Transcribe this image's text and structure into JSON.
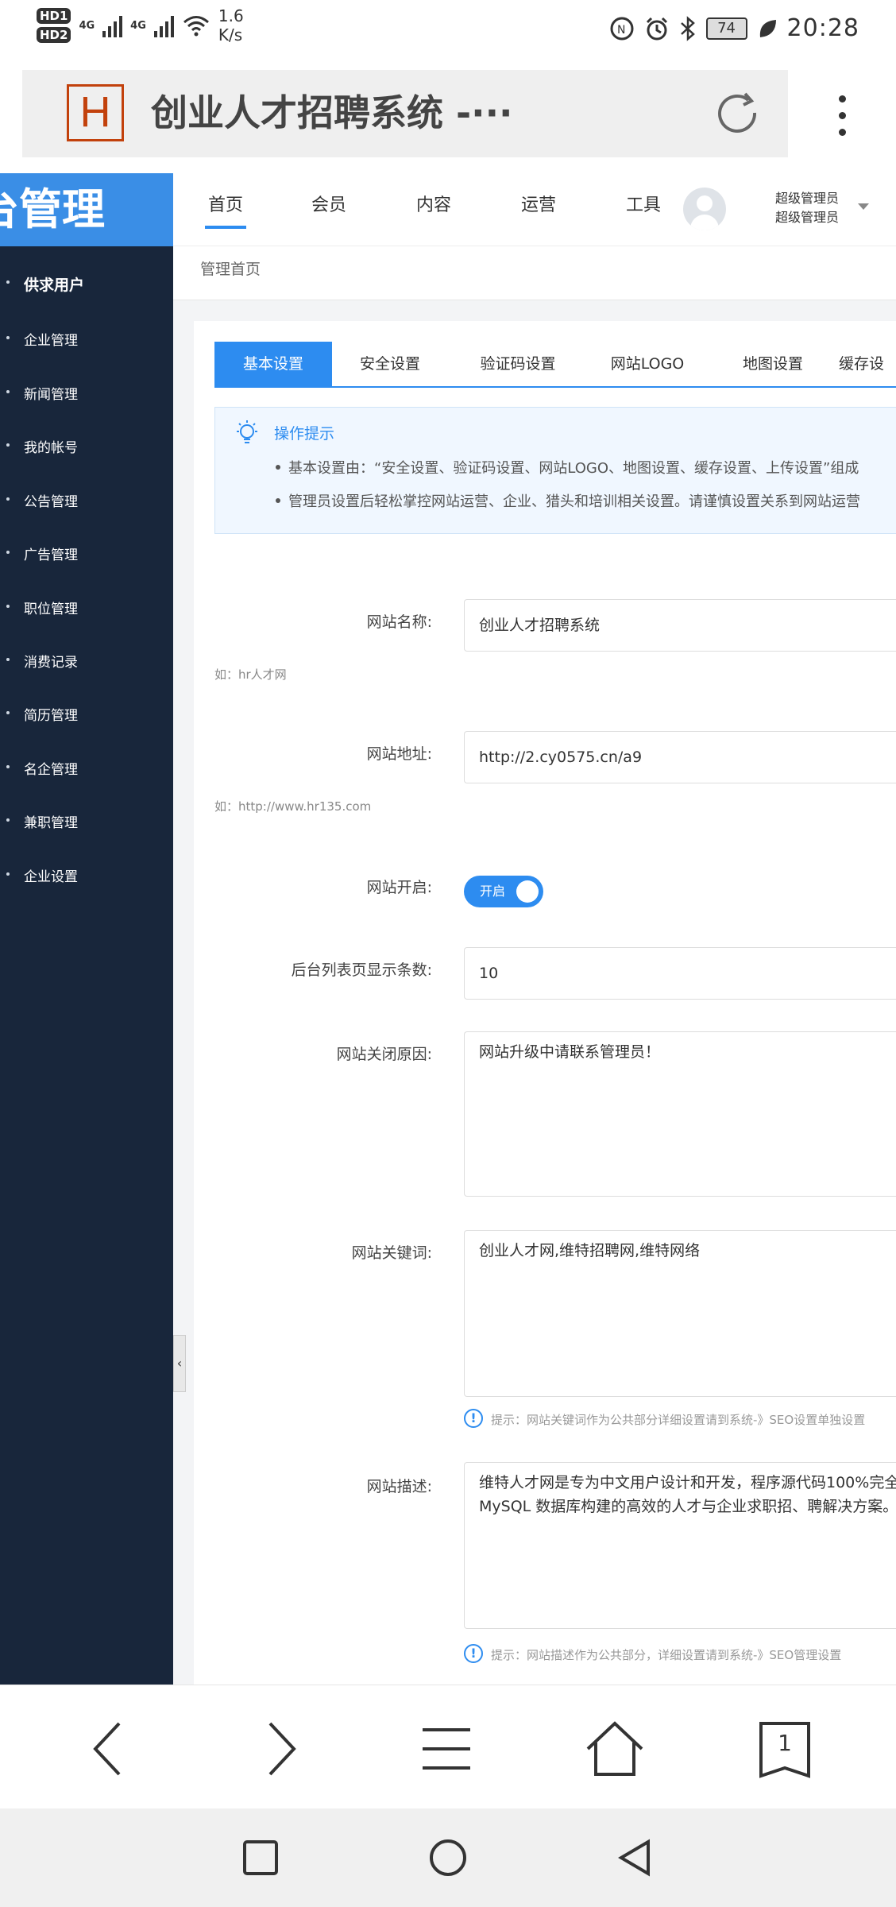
{
  "status_bar": {
    "hd1": "HD1",
    "hd2": "HD2",
    "net1": "4G",
    "net2": "4G",
    "speed_value": "1.6",
    "speed_unit": "K/s",
    "battery": "74",
    "time": "20:28"
  },
  "browser": {
    "logo_letter": "H",
    "title": "创业人才招聘系统 -···"
  },
  "app": {
    "brand": "台管理",
    "nav": [
      "首页",
      "会员",
      "内容",
      "运营",
      "工具"
    ],
    "user_line1": "超级管理员",
    "user_line2": "超级管理员"
  },
  "sidebar": {
    "items": [
      "供求用户",
      "企业管理",
      "新闻管理",
      "我的帐号",
      "公告管理",
      "广告管理",
      "职位管理",
      "消费记录",
      "简历管理",
      "名企管理",
      "兼职管理",
      "企业设置"
    ]
  },
  "breadcrumb": "管理首页",
  "tabs": [
    "基本设置",
    "安全设置",
    "验证码设置",
    "网站LOGO",
    "地图设置",
    "缓存设"
  ],
  "tip": {
    "title": "操作提示",
    "line1": "基本设置由：“安全设置、验证码设置、网站LOGO、地图设置、缓存设置、上传设置”组成",
    "line2": "管理员设置后轻松掌控网站运营、企业、猎头和培训相关设置。请谨慎设置关系到网站运营"
  },
  "form": {
    "site_name_label": "网站名称:",
    "site_name_value": "创业人才招聘系统",
    "site_name_hint": "如：hr人才网",
    "site_url_label": "网站地址:",
    "site_url_value": "http://2.cy0575.cn/a9",
    "site_url_hint": "如：http://www.hr135.com",
    "site_open_label": "网站开启:",
    "site_open_toggle": "开启",
    "page_size_label": "后台列表页显示条数:",
    "page_size_value": "10",
    "close_reason_label": "网站关闭原因:",
    "close_reason_value": "网站升级中请联系管理员！",
    "keywords_label": "网站关键词:",
    "keywords_value": "创业人才网,维特招聘网,维特网络",
    "keywords_note": "提示：网站关键词作为公共部分详细设置请到系统-》SEO设置单独设置",
    "desc_label": "网站描述:",
    "desc_line1": "维特人才网是专为中文用户设计和开发，程序源代码100%完全",
    "desc_line2": "MySQL 数据库构建的高效的人才与企业求职招、聘解决方案。",
    "desc_note": "提示：网站描述作为公共部分，详细设置请到系统-》SEO管理设置"
  },
  "browser_nav": {
    "tab_count": "1"
  }
}
